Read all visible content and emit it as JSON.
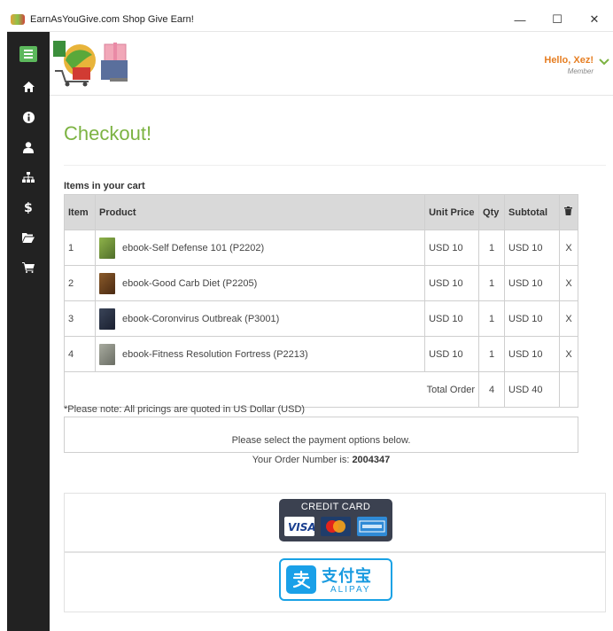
{
  "window": {
    "title": "EarnAsYouGive.com Shop Give Earn!",
    "minimize": "—",
    "maximize": "☐",
    "close": "✕"
  },
  "header": {
    "greeting": "Hello, Xez!",
    "role": "Member"
  },
  "page": {
    "title": "Checkout!",
    "cart_caption": "Items in your cart"
  },
  "cart": {
    "headers": {
      "item": "Item",
      "product": "Product",
      "unit_price": "Unit Price",
      "qty": "Qty",
      "subtotal": "Subtotal"
    },
    "rows": [
      {
        "item": "1",
        "product": "ebook-Self Defense 101 (P2202)",
        "unit_price": "USD 10",
        "qty": "1",
        "subtotal": "USD 10",
        "remove": "X",
        "thumb_color": "#6a8f3a"
      },
      {
        "item": "2",
        "product": "ebook-Good Carb Diet (P2205)",
        "unit_price": "USD 10",
        "qty": "1",
        "subtotal": "USD 10",
        "remove": "X",
        "thumb_color": "#6b3b1c"
      },
      {
        "item": "3",
        "product": "ebook-Coronvirus Outbreak (P3001)",
        "unit_price": "USD 10",
        "qty": "1",
        "subtotal": "USD 10",
        "remove": "X",
        "thumb_color": "#2a3346"
      },
      {
        "item": "4",
        "product": "ebook-Fitness Resolution Fortress (P2213)",
        "unit_price": "USD 10",
        "qty": "1",
        "subtotal": "USD 10",
        "remove": "X",
        "thumb_color": "#8a8d84"
      }
    ],
    "total_label": "Total Order",
    "total_qty": "4",
    "total_amount": "USD 40"
  },
  "notes": {
    "pricing": "*Please note: All pricings are quoted in US Dollar (USD)",
    "select_payment": "Please select the payment options below.",
    "order_label": "Your Order Number is:",
    "order_number": "2004347"
  },
  "payment": {
    "credit_card_label": "CREDIT CARD",
    "alipay_cn": "支付宝",
    "alipay_en": "ALIPAY"
  },
  "colors": {
    "sidebar": "#222222",
    "accent_green": "#7cb342",
    "menu_button": "#5cb85c",
    "greeting": "#e67e22",
    "link_blue": "#3a7bd5",
    "alipay_blue": "#1aa0e8"
  }
}
